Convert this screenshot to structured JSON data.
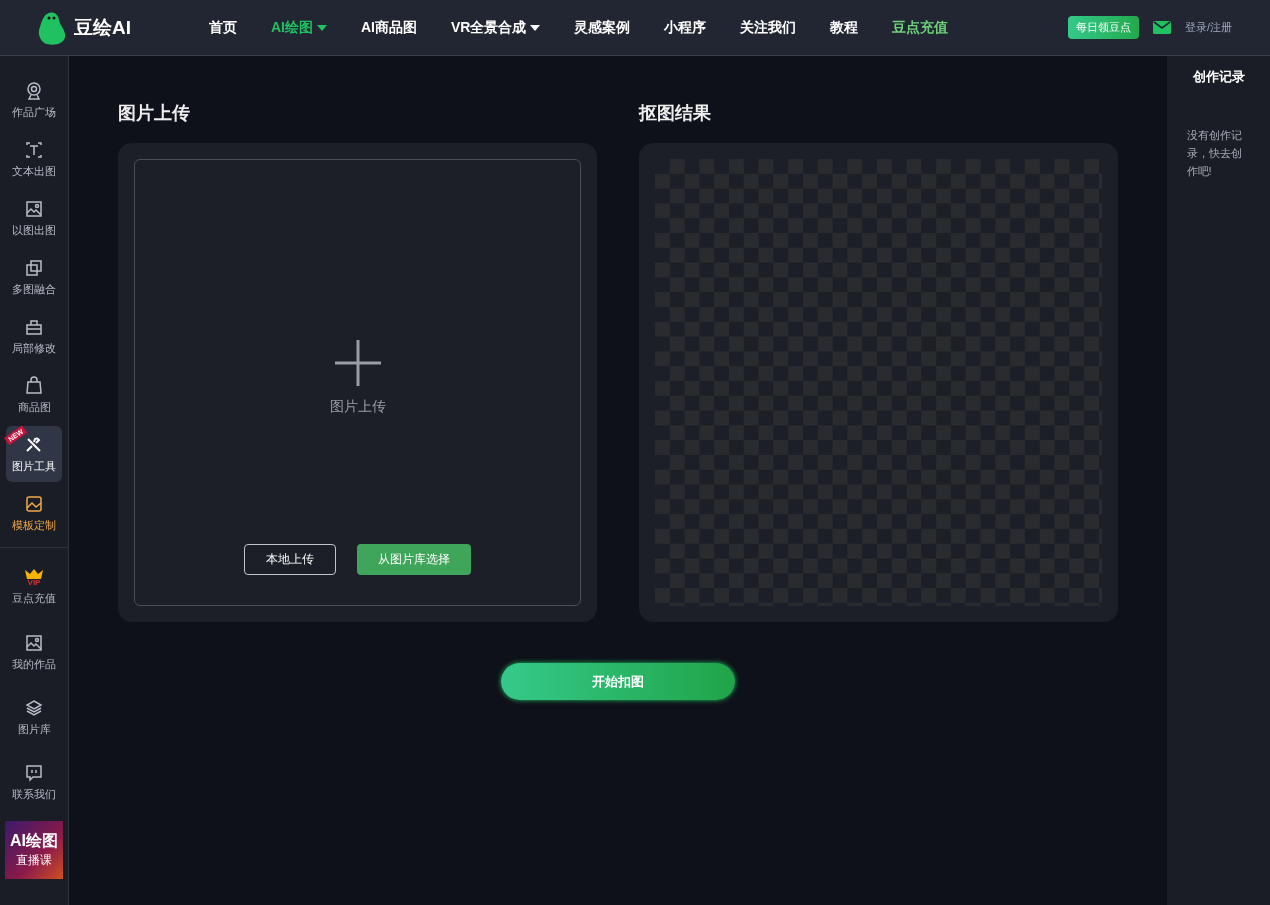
{
  "header": {
    "logo_text": "豆绘AI",
    "nav": [
      {
        "label": "首页",
        "kind": "link",
        "selected": false,
        "dropdown": false
      },
      {
        "label": "AI绘图",
        "kind": "link",
        "selected": true,
        "dropdown": true
      },
      {
        "label": "AI商品图",
        "kind": "link",
        "selected": false,
        "dropdown": false
      },
      {
        "label": "VR全景合成",
        "kind": "link",
        "selected": false,
        "dropdown": true
      },
      {
        "label": "灵感案例",
        "kind": "link",
        "selected": false,
        "dropdown": false
      },
      {
        "label": "小程序",
        "kind": "link",
        "selected": false,
        "dropdown": false
      },
      {
        "label": "关注我们",
        "kind": "link",
        "selected": false,
        "dropdown": false
      },
      {
        "label": "教程",
        "kind": "link",
        "selected": false,
        "dropdown": false
      },
      {
        "label": "豆点充值",
        "kind": "promo",
        "selected": false,
        "dropdown": false
      }
    ],
    "daily_button": "每日领豆点",
    "login": "登录/注册"
  },
  "sidebar": {
    "tools": [
      {
        "label": "作品广场",
        "kind": "plain",
        "selected": false
      },
      {
        "label": "文本出图",
        "kind": "plain",
        "selected": false
      },
      {
        "label": "以图出图",
        "kind": "plain",
        "selected": false
      },
      {
        "label": "多图融合",
        "kind": "plain",
        "selected": false
      },
      {
        "label": "局部修改",
        "kind": "plain",
        "selected": false
      },
      {
        "label": "商品图",
        "kind": "plain",
        "selected": false
      },
      {
        "label": "图片工具",
        "kind": "plain",
        "selected": true,
        "badge": "NEW"
      },
      {
        "label": "模板定制",
        "kind": "accent",
        "selected": false
      }
    ],
    "account": [
      {
        "label": "豆点充值",
        "vip": "VIP"
      },
      {
        "label": "我的作品"
      },
      {
        "label": "图片库"
      },
      {
        "label": "联系我们"
      }
    ],
    "banner": {
      "title": "AI绘图",
      "subtitle": "直播课"
    }
  },
  "upload": {
    "title": "图片上传",
    "hint": "图片上传",
    "buttons": [
      {
        "label": "本地上传",
        "kind": "outline"
      },
      {
        "label": "从图片库选择",
        "kind": "filled"
      }
    ]
  },
  "result": {
    "title": "抠图结果"
  },
  "start_button": "开始扣图",
  "history": {
    "title": "创作记录",
    "empty": "没有创作记录，快去创作吧!"
  }
}
